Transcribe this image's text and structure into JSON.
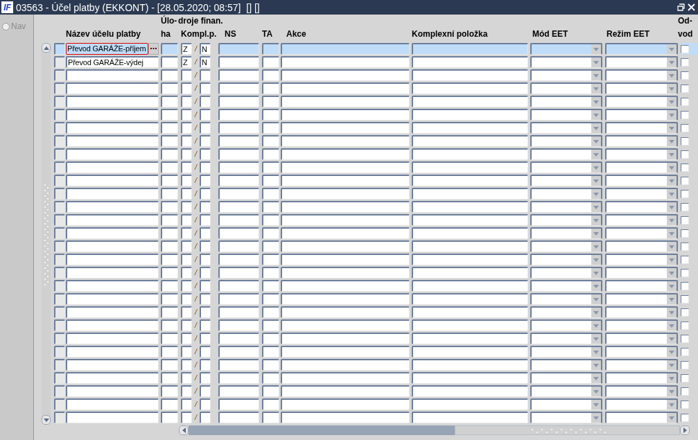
{
  "window": {
    "logo": "IF",
    "title": "03563 - Účel platby (EKKONT) - [28.05.2020; 08:57]  [] []"
  },
  "nav": {
    "label": "Nav",
    "selected": false
  },
  "columns": {
    "name": "Název účelu platby",
    "uloha": [
      "Úlo-",
      "ha"
    ],
    "zdroje": "droje finan.",
    "kompl": "Kompl.p.",
    "ns": "NS",
    "ta": "TA",
    "akce": "Akce",
    "komplexni": "Komplexní položka",
    "mod": "Mód EET",
    "rezim": "Režim EET",
    "odvod": [
      "Od-",
      "vod"
    ]
  },
  "rows": [
    {
      "selected": true,
      "focused": true,
      "name": "Převod GARÁŽE-příjem",
      "zdroj": "Z",
      "sep": "/",
      "kompl": "N",
      "odvod": false
    },
    {
      "selected": false,
      "focused": false,
      "name": "Převod GARÁŽE-výdej",
      "zdroj": "Z",
      "sep": "/",
      "kompl": "N",
      "odvod": false
    },
    {
      "selected": false,
      "focused": false,
      "sep": "/",
      "odvod": false
    },
    {
      "selected": false,
      "focused": false,
      "sep": "/",
      "odvod": false
    },
    {
      "selected": false,
      "focused": false,
      "sep": "/",
      "odvod": false
    },
    {
      "selected": false,
      "focused": false,
      "sep": "/",
      "odvod": false
    },
    {
      "selected": false,
      "focused": false,
      "sep": "/",
      "odvod": false
    },
    {
      "selected": false,
      "focused": false,
      "sep": "/",
      "odvod": false
    },
    {
      "selected": false,
      "focused": false,
      "sep": "/",
      "odvod": false
    },
    {
      "selected": false,
      "focused": false,
      "sep": "/",
      "odvod": false
    },
    {
      "selected": false,
      "focused": false,
      "sep": "/",
      "odvod": false
    },
    {
      "selected": false,
      "focused": false,
      "sep": "/",
      "odvod": false
    },
    {
      "selected": false,
      "focused": false,
      "sep": "/",
      "odvod": false
    },
    {
      "selected": false,
      "focused": false,
      "sep": "/",
      "odvod": false
    },
    {
      "selected": false,
      "focused": false,
      "sep": "/",
      "odvod": false
    },
    {
      "selected": false,
      "focused": false,
      "sep": "/",
      "odvod": false
    },
    {
      "selected": false,
      "focused": false,
      "sep": "/",
      "odvod": false
    },
    {
      "selected": false,
      "focused": false,
      "sep": "/",
      "odvod": false
    },
    {
      "selected": false,
      "focused": false,
      "sep": "/",
      "odvod": false
    },
    {
      "selected": false,
      "focused": false,
      "sep": "/",
      "odvod": false
    },
    {
      "selected": false,
      "focused": false,
      "sep": "/",
      "odvod": false
    },
    {
      "selected": false,
      "focused": false,
      "sep": "/",
      "odvod": false
    },
    {
      "selected": false,
      "focused": false,
      "sep": "/",
      "odvod": false
    },
    {
      "selected": false,
      "focused": false,
      "sep": "/",
      "odvod": false
    },
    {
      "selected": false,
      "focused": false,
      "sep": "/",
      "odvod": false
    },
    {
      "selected": false,
      "focused": false,
      "sep": "/",
      "odvod": false
    },
    {
      "selected": false,
      "focused": false,
      "sep": "/",
      "odvod": false
    },
    {
      "selected": false,
      "focused": false,
      "sep": "/",
      "odvod": false
    },
    {
      "selected": false,
      "focused": false,
      "sep": "/",
      "odvod": false
    }
  ]
}
